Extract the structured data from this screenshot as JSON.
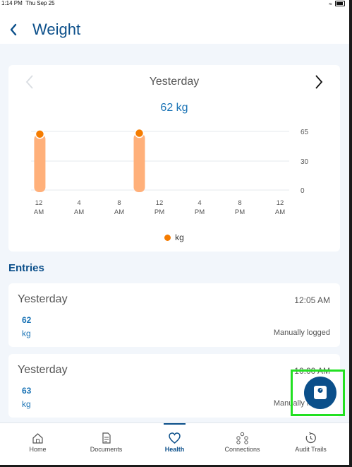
{
  "status_bar": {
    "time": "1:14 PM",
    "date": "Thu Sep 25"
  },
  "header": {
    "title": "Weight"
  },
  "chart": {
    "date_label": "Yesterday",
    "value_label": "62 kg",
    "legend_label": "kg",
    "accent_color": "#f57c00",
    "bar_color": "#ffb07a"
  },
  "chart_data": {
    "type": "bar",
    "y_ticks": [
      "65",
      "30",
      "0"
    ],
    "ylim": [
      0,
      65
    ],
    "x_tick_labels": [
      [
        "12",
        "AM"
      ],
      [
        "4",
        "AM"
      ],
      [
        "8",
        "AM"
      ],
      [
        "12",
        "PM"
      ],
      [
        "4",
        "PM"
      ],
      [
        "8",
        "PM"
      ],
      [
        "12",
        "AM"
      ]
    ],
    "x_range_hours": [
      0,
      24
    ],
    "series": [
      {
        "name": "kg",
        "points": [
          {
            "hour": 0.1,
            "value": 62
          },
          {
            "hour": 10.0,
            "value": 63
          }
        ]
      }
    ],
    "legend_position": "bottom",
    "grid": true
  },
  "entries": {
    "title": "Entries",
    "items": [
      {
        "date": "Yesterday",
        "time": "12:05 AM",
        "value": "62",
        "unit": "kg",
        "source": "Manually logged"
      },
      {
        "date": "Yesterday",
        "time": "10:00 AM",
        "value": "63",
        "unit": "kg",
        "source": "Manually logged"
      }
    ]
  },
  "fab": {
    "icon": "weighing-scale-icon"
  },
  "bottom_nav": {
    "items": [
      {
        "label": "Home",
        "icon": "home-icon"
      },
      {
        "label": "Documents",
        "icon": "document-icon"
      },
      {
        "label": "Health",
        "icon": "heart-icon",
        "active": true
      },
      {
        "label": "Connections",
        "icon": "connections-icon"
      },
      {
        "label": "Audit Trails",
        "icon": "history-icon"
      }
    ]
  },
  "colors": {
    "primary": "#0b4f8a",
    "link": "#1a73b5",
    "highlight": "#22e022"
  }
}
